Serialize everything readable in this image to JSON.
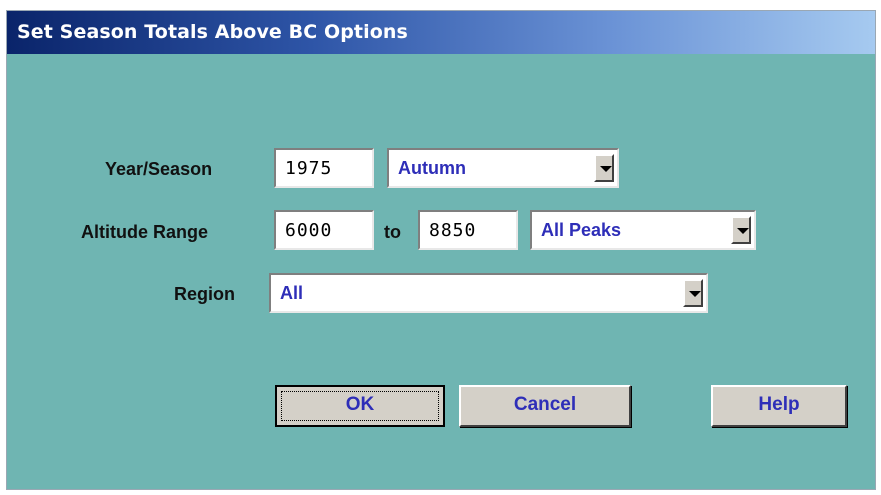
{
  "window": {
    "title": "Set Season Totals Above BC Options"
  },
  "year_season": {
    "label": "Year/Season",
    "year_value": "1975",
    "season_selected": "Autumn"
  },
  "altitude": {
    "label": "Altitude Range",
    "from_value": "6000",
    "to_label": "to",
    "to_value": "8850",
    "peaks_selected": "All Peaks"
  },
  "region": {
    "label": "Region",
    "selected": "All"
  },
  "buttons": {
    "ok": "OK",
    "cancel": "Cancel",
    "help": "Help"
  },
  "colors": {
    "dialog_bg": "#6fb5b2",
    "combo_text": "#2e2eb8",
    "title_bar": "#0a246a"
  }
}
